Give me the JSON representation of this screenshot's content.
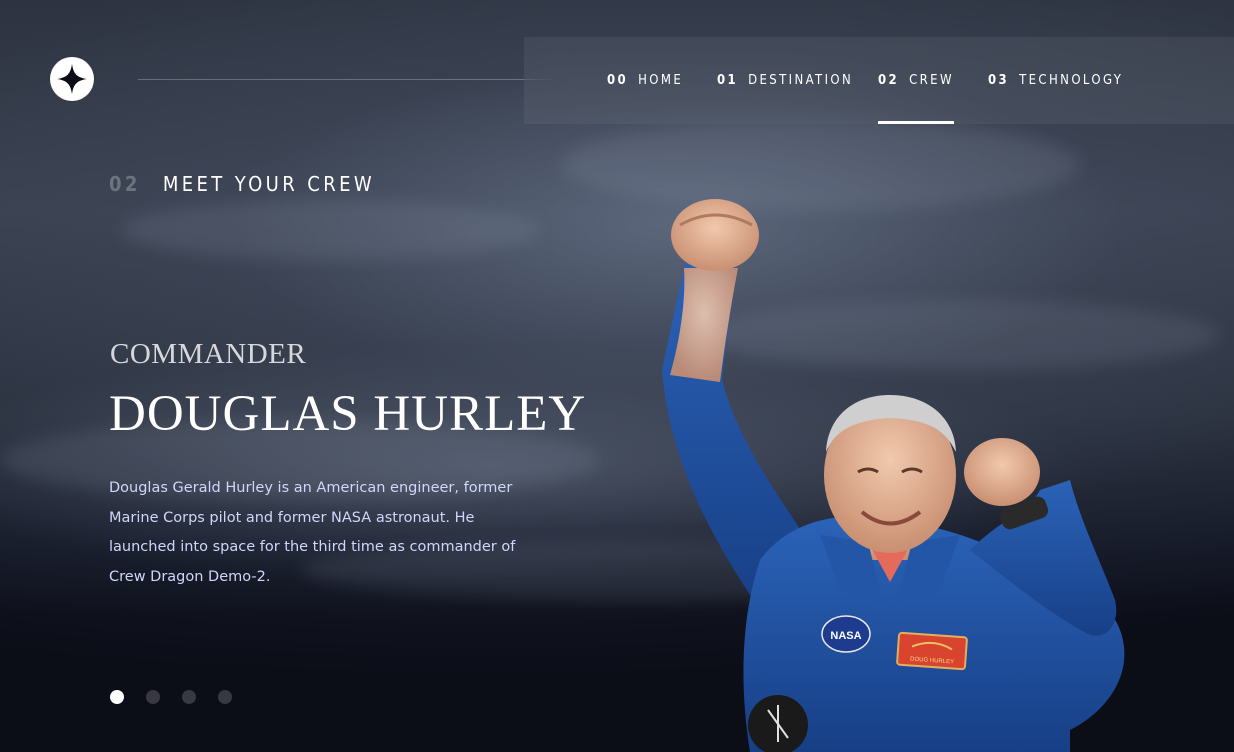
{
  "header": {
    "logo_icon": "star-logo-icon",
    "nav": [
      {
        "number": "00",
        "label": "HOME",
        "active": false
      },
      {
        "number": "01",
        "label": "DESTINATION",
        "active": false
      },
      {
        "number": "02",
        "label": "CREW",
        "active": true
      },
      {
        "number": "03",
        "label": "TECHNOLOGY",
        "active": false
      }
    ]
  },
  "page_heading": {
    "number": "02",
    "title": "MEET YOUR CREW"
  },
  "crew": {
    "role": "COMMANDER",
    "name": "DOUGLAS HURLEY",
    "bio": "Douglas Gerald Hurley is an American engineer, former Marine Corps pilot and former NASA astronaut. He launched into space for the third time as commander of Crew Dragon Demo-2.",
    "badge_text": "NASA",
    "patch_text": "DOUG HURLEY"
  },
  "slider": {
    "count": 4,
    "active_index": 0
  },
  "colors": {
    "background": "#0b0d17",
    "text_light": "#d0d6f9",
    "white": "#ffffff",
    "suit_blue": "#1f4fa0"
  }
}
